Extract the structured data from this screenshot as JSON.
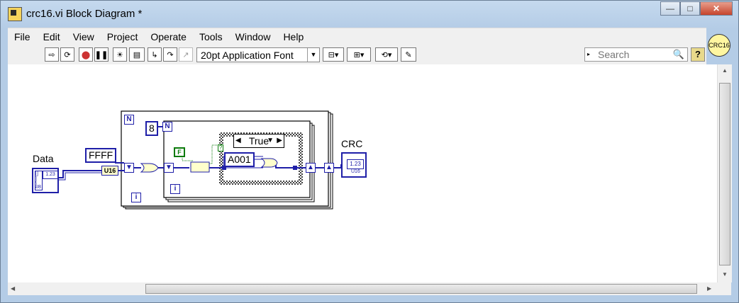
{
  "window": {
    "title": "crc16.vi Block Diagram *",
    "buttons": {
      "minimize": "—",
      "maximize": "□",
      "close": "✕"
    }
  },
  "menu": [
    "File",
    "Edit",
    "View",
    "Project",
    "Operate",
    "Tools",
    "Window",
    "Help"
  ],
  "toolbar": {
    "font": "20pt Application Font",
    "search_placeholder": "Search",
    "help": "?"
  },
  "vi_icon": "CRC16",
  "diagram": {
    "data_label": "Data",
    "data_type": "U8",
    "ffff_const": "FFFF",
    "u16_conv": "U16",
    "outer_count": "N",
    "outer_iter": "i",
    "inner_count_const": "8",
    "inner_count": "N",
    "inner_iter": "i",
    "false_const": "F",
    "case_selector": "True",
    "poly_const": "A001",
    "crc_label": "CRC",
    "crc_type": "U16",
    "crc_display": "1.23",
    "data_display": "1.23"
  }
}
